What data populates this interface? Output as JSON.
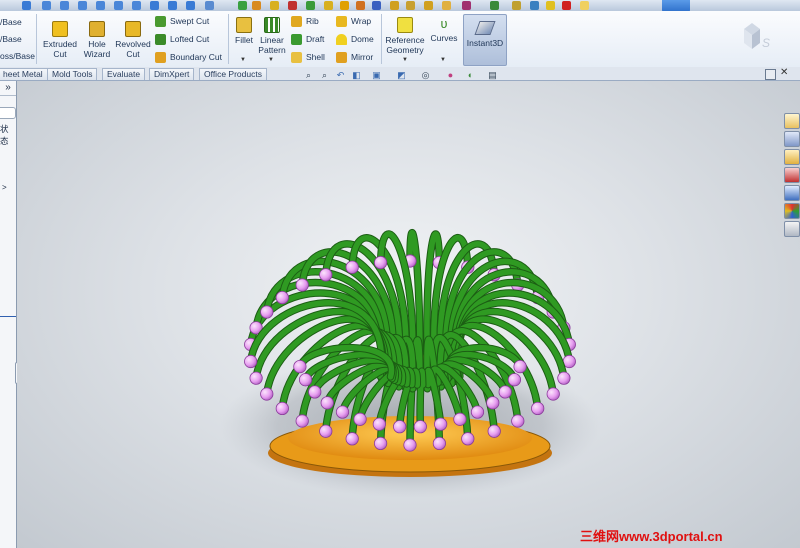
{
  "ribbon": {
    "left_items": [
      "/Base",
      "/Base",
      "oss/Base"
    ],
    "extruded_cut": "Extruded Cut",
    "hole_wizard": "Hole Wizard",
    "revolved_cut": "Revolved Cut",
    "swept_cut": "Swept Cut",
    "lofted_cut": "Lofted Cut",
    "boundary_cut": "Boundary Cut",
    "fillet": "Fillet",
    "linear_pattern": "Linear Pattern",
    "rib": "Rib",
    "draft": "Draft",
    "shell": "Shell",
    "wrap": "Wrap",
    "dome": "Dome",
    "mirror": "Mirror",
    "reference_geometry": "Reference Geometry",
    "curves": "Curves",
    "instant3d": "Instant3D"
  },
  "tabs": [
    "heet Metal",
    "Mold Tools",
    "Evaluate",
    "DimXpert",
    "Office Products"
  ],
  "left_panel": {
    "collapse": "»",
    "status_text": "状态",
    "arrow": ">"
  },
  "watermark": "三维网www.3dportal.cn",
  "colors": {
    "stem": "#2f9a22",
    "tip": "#e7a0ee",
    "base": "#f0a020",
    "ribbon_bg": "#eef3f9",
    "viewport_bg": "#dde1e6"
  },
  "icons": [
    "zoom-to-fit-icon",
    "zoom-area-icon",
    "previous-view-icon",
    "section-view-icon",
    "view-orientation-icon",
    "display-style-icon",
    "hide-show-icon",
    "appearance-icon",
    "scene-icon",
    "view-settings-icon"
  ]
}
